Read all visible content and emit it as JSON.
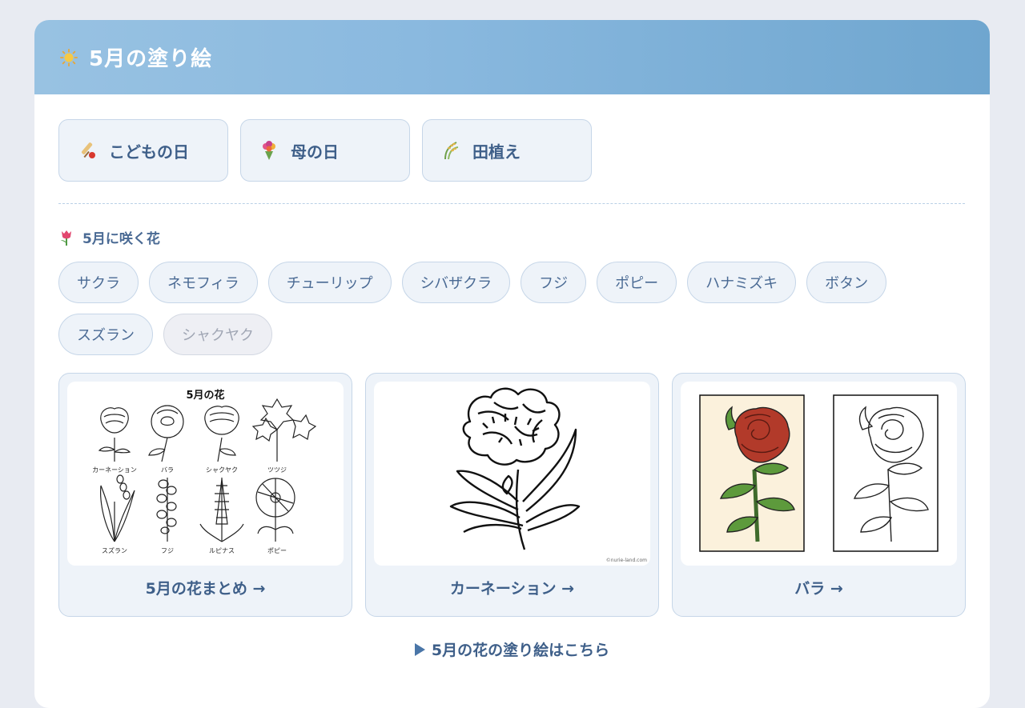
{
  "header": {
    "title": "5月の塗り絵"
  },
  "events": [
    {
      "label": "こどもの日",
      "icon": "cricket-bat-icon"
    },
    {
      "label": "母の日",
      "icon": "bouquet-icon"
    },
    {
      "label": "田植え",
      "icon": "rice-plant-icon"
    }
  ],
  "section": {
    "title": "5月に咲く花",
    "icon": "tulip-icon"
  },
  "tags": [
    "サクラ",
    "ネモフィラ",
    "チューリップ",
    "シバザクラ",
    "フジ",
    "ポピー",
    "ハナミズキ",
    "ボタン",
    "スズラン",
    "シャクヤク"
  ],
  "tiles": [
    {
      "caption": "5月の花まとめ →",
      "sheet": {
        "title": "5月の花",
        "labels": [
          "カーネーション",
          "バラ",
          "シャクヤク",
          "ツツジ",
          "スズラン",
          "フジ",
          "ルピナス",
          "ポピー"
        ]
      }
    },
    {
      "caption": "カーネーション →",
      "credit": "©nurie-land.com"
    },
    {
      "caption": "バラ →"
    }
  ],
  "more_link": "5月の花の塗り絵はこちら",
  "colors": {
    "header_start": "#98c2e2",
    "header_end": "#6fa6cf",
    "accent_text": "#3e5f89",
    "chip_bg": "#eef3f9",
    "chip_border": "#c6d6e8"
  }
}
